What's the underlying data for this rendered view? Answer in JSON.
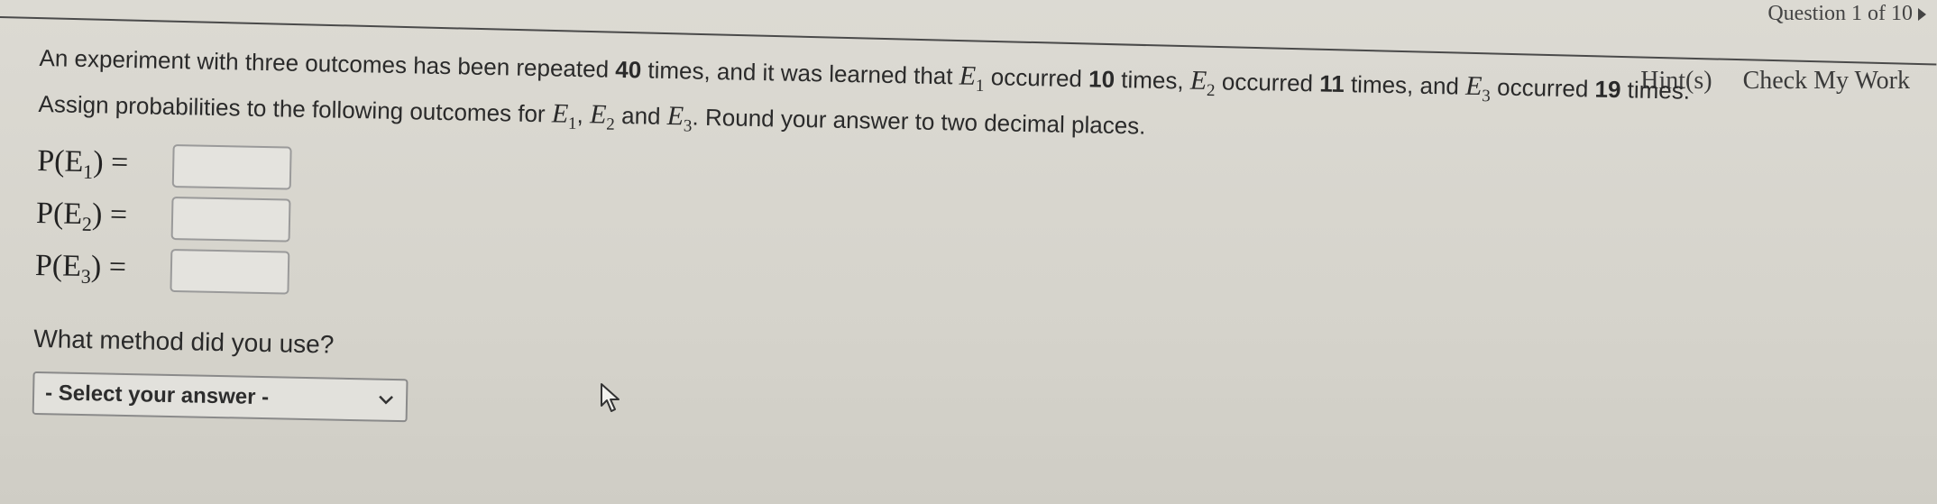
{
  "nav": {
    "question_indicator": "Question 1 of 10"
  },
  "links": {
    "hints": "Hint(s)",
    "check_work": "Check My Work"
  },
  "problem": {
    "line1_a": "An experiment with three outcomes has been repeated ",
    "trials": "40",
    "line1_b": " times, and it was learned that ",
    "e1_sym": "E",
    "e1_sub": "1",
    "line1_c": " occurred ",
    "e1_count": "10",
    "line1_d": " times, ",
    "e2_sym": "E",
    "e2_sub": "2",
    "line1_e": " occurred ",
    "e2_count": "11",
    "line1_f": " times, and ",
    "e3_sym": "E",
    "e3_sub": "3",
    "line1_g": " occurred ",
    "e3_count": "19",
    "line1_h": " times.",
    "line2_a": "Assign probabilities to the following outcomes for ",
    "line2_sep1": ", ",
    "line2_sep2": " and ",
    "line2_b": ". Round your answer to two decimal places."
  },
  "answers": [
    {
      "label_prefix": "P(E",
      "sub": "1",
      "label_suffix": ") =",
      "value": ""
    },
    {
      "label_prefix": "P(E",
      "sub": "2",
      "label_suffix": ") =",
      "value": ""
    },
    {
      "label_prefix": "P(E",
      "sub": "3",
      "label_suffix": ") =",
      "value": ""
    }
  ],
  "method": {
    "question": "What method did you use?",
    "selected": "- Select your answer -"
  },
  "icons": {
    "dropdown": "chevron-down-icon",
    "nav": "caret-right-icon",
    "cursor": "mouse-pointer-icon"
  }
}
